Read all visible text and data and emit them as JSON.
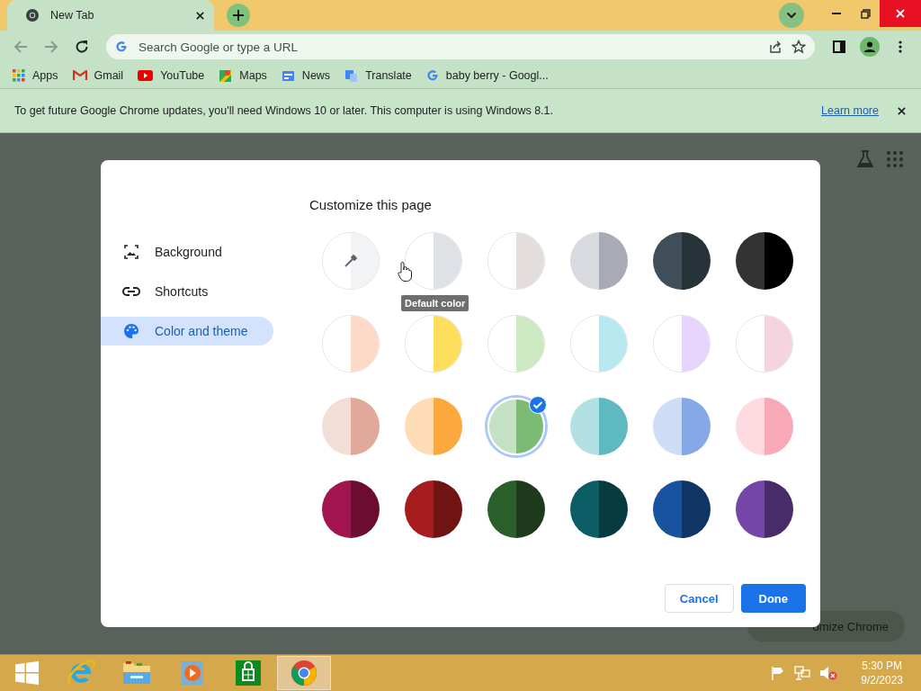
{
  "window": {
    "tab": {
      "title": "New Tab"
    }
  },
  "omnibox": {
    "placeholder": "Search Google or type a URL"
  },
  "bookmarks": [
    {
      "kind": "apps",
      "label": "Apps"
    },
    {
      "kind": "gmail",
      "label": "Gmail"
    },
    {
      "kind": "youtube",
      "label": "YouTube"
    },
    {
      "kind": "maps",
      "label": "Maps"
    },
    {
      "kind": "news",
      "label": "News"
    },
    {
      "kind": "translate",
      "label": "Translate"
    },
    {
      "kind": "google",
      "label": "baby berry - Googl..."
    }
  ],
  "infobar": {
    "message": "To get future Google Chrome updates, you'll need Windows 10 or later. This computer is using Windows 8.1.",
    "link": "Learn more"
  },
  "page": {
    "customize_button": "omize Chrome"
  },
  "dialog": {
    "title": "Customize this page",
    "nav": [
      {
        "kind": "image",
        "label": "Background",
        "selected": false
      },
      {
        "kind": "link",
        "label": "Shortcuts",
        "selected": false
      },
      {
        "kind": "palette",
        "label": "Color and theme",
        "selected": true
      }
    ],
    "colors": [
      {
        "kind": "custom",
        "halves": [
          {
            "color": "#ffffff"
          },
          {
            "color": "#f1f3f4"
          }
        ],
        "selected": false
      },
      {
        "kind": "preset",
        "halves": [
          {
            "color": "#ffffff"
          },
          {
            "color": "#dee1e6"
          }
        ],
        "selected": false,
        "tooltip": "Default color"
      },
      {
        "kind": "preset",
        "halves": [
          {
            "color": "#ffffff"
          },
          {
            "color": "#e3dedb"
          }
        ],
        "selected": false
      },
      {
        "kind": "preset",
        "halves": [
          {
            "color": "#d9dadf"
          },
          {
            "color": "#a8abb6"
          }
        ],
        "selected": false
      },
      {
        "kind": "preset",
        "halves": [
          {
            "color": "#3f4e59"
          },
          {
            "color": "#283339"
          }
        ],
        "selected": false
      },
      {
        "kind": "preset",
        "halves": [
          {
            "color": "#333333"
          },
          {
            "color": "#000000"
          }
        ],
        "selected": false
      },
      {
        "kind": "preset",
        "halves": [
          {
            "color": "#ffffff"
          },
          {
            "color": "#fdd9c7"
          }
        ],
        "selected": false
      },
      {
        "kind": "preset",
        "halves": [
          {
            "color": "#ffffff"
          },
          {
            "color": "#fedf5d"
          }
        ],
        "selected": false
      },
      {
        "kind": "preset",
        "halves": [
          {
            "color": "#ffffff"
          },
          {
            "color": "#cde9c2"
          }
        ],
        "selected": false
      },
      {
        "kind": "preset",
        "halves": [
          {
            "color": "#ffffff"
          },
          {
            "color": "#b7e7ef"
          }
        ],
        "selected": false
      },
      {
        "kind": "preset",
        "halves": [
          {
            "color": "#ffffff"
          },
          {
            "color": "#e6d4fc"
          }
        ],
        "selected": false
      },
      {
        "kind": "preset",
        "halves": [
          {
            "color": "#ffffff"
          },
          {
            "color": "#f5d4e0"
          }
        ],
        "selected": false
      },
      {
        "kind": "preset",
        "halves": [
          {
            "color": "#f3ddd7"
          },
          {
            "color": "#e0a99a"
          }
        ],
        "selected": false
      },
      {
        "kind": "preset",
        "halves": [
          {
            "color": "#fddcb6"
          },
          {
            "color": "#fba93e"
          }
        ],
        "selected": false
      },
      {
        "kind": "preset",
        "halves": [
          {
            "color": "#c5e1c4"
          },
          {
            "color": "#7cbb73"
          }
        ],
        "selected": true
      },
      {
        "kind": "preset",
        "halves": [
          {
            "color": "#b3e0e3"
          },
          {
            "color": "#5eb9c0"
          }
        ],
        "selected": false
      },
      {
        "kind": "preset",
        "halves": [
          {
            "color": "#cfdcf6"
          },
          {
            "color": "#86a8e6"
          }
        ],
        "selected": false
      },
      {
        "kind": "preset",
        "halves": [
          {
            "color": "#fddbe1"
          },
          {
            "color": "#f9a8b7"
          }
        ],
        "selected": false
      },
      {
        "kind": "preset",
        "halves": [
          {
            "color": "#a3154f"
          },
          {
            "color": "#6c0c31"
          }
        ],
        "selected": false
      },
      {
        "kind": "preset",
        "halves": [
          {
            "color": "#a61c1f"
          },
          {
            "color": "#701413"
          }
        ],
        "selected": false
      },
      {
        "kind": "preset",
        "halves": [
          {
            "color": "#2a5f2b"
          },
          {
            "color": "#1d3b1c"
          }
        ],
        "selected": false
      },
      {
        "kind": "preset",
        "halves": [
          {
            "color": "#0b5e65"
          },
          {
            "color": "#063c40"
          }
        ],
        "selected": false
      },
      {
        "kind": "preset",
        "halves": [
          {
            "color": "#1953a0"
          },
          {
            "color": "#0f3565"
          }
        ],
        "selected": false
      },
      {
        "kind": "preset",
        "halves": [
          {
            "color": "#7446a8"
          },
          {
            "color": "#482c69"
          }
        ],
        "selected": false
      }
    ],
    "buttons": {
      "cancel": "Cancel",
      "done": "Done"
    }
  },
  "taskbar": {
    "apps": [
      {
        "kind": "ie",
        "selected": false
      },
      {
        "kind": "explorer",
        "selected": false
      },
      {
        "kind": "media",
        "selected": false
      },
      {
        "kind": "store",
        "selected": false
      },
      {
        "kind": "chrome",
        "selected": true
      }
    ],
    "time": "5:30 PM",
    "date": "9/2/2023"
  }
}
